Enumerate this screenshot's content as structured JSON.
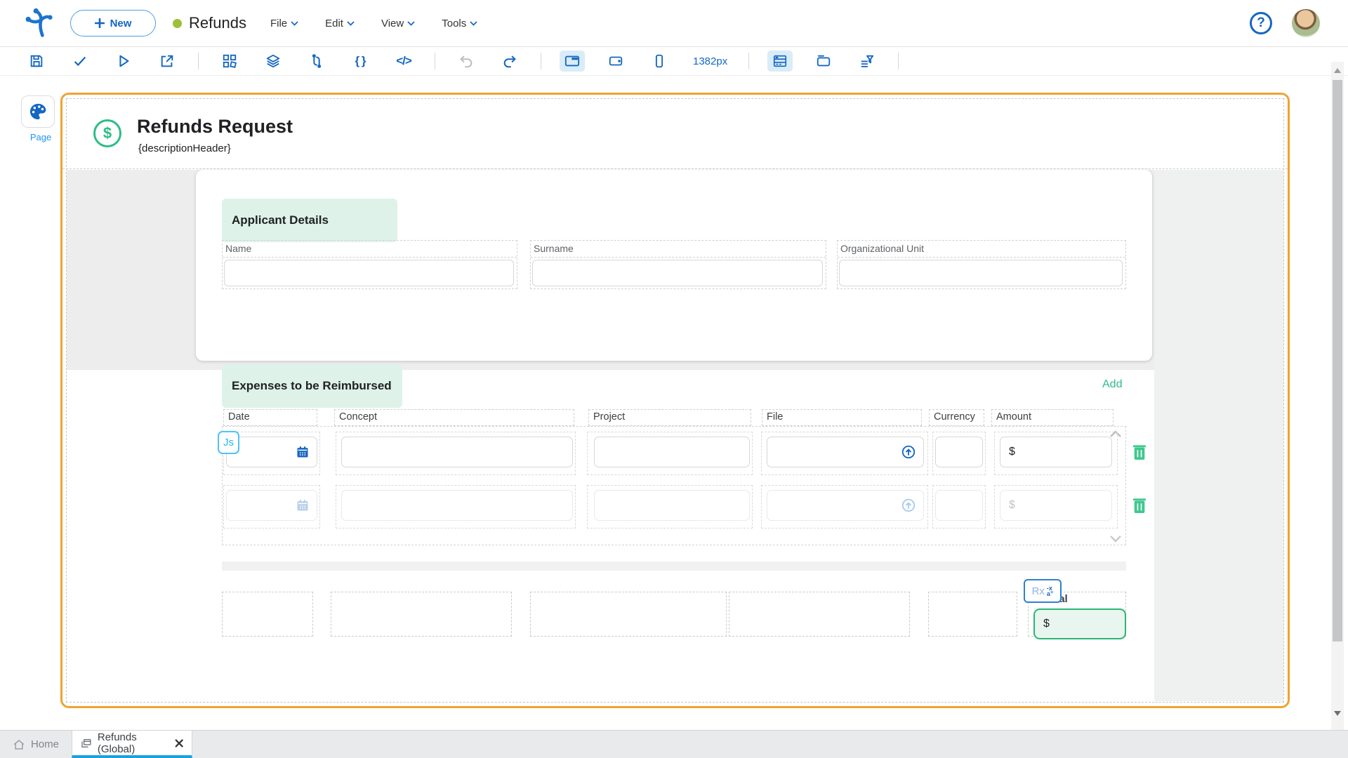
{
  "topbar": {
    "new_label": "New",
    "app_title": "Refunds",
    "menus": [
      {
        "label": "File"
      },
      {
        "label": "Edit"
      },
      {
        "label": "View"
      },
      {
        "label": "Tools"
      }
    ],
    "help_glyph": "?"
  },
  "toolbar": {
    "width_label": "1382px",
    "braces_glyph": "{ }",
    "code_glyph": "</>"
  },
  "sidebar": {
    "page_label": "Page"
  },
  "canvas": {
    "header": {
      "title": "Refunds Request",
      "subtitle": "{descriptionHeader}",
      "currency_icon": "$"
    },
    "applicant": {
      "section_title": "Applicant Details",
      "fields": [
        {
          "label": "Name"
        },
        {
          "label": "Surname"
        },
        {
          "label": "Organizational Unit"
        }
      ]
    },
    "expenses": {
      "section_title": "Expenses to be Reimbursed",
      "add_label": "Add",
      "columns": [
        "Date",
        "Concept",
        "Project",
        "File",
        "Currency",
        "Amount"
      ],
      "js_badge": "Js",
      "rx_badge": "Rx",
      "rx_glyph_top": "-x",
      "rx_glyph_bottom": "a”",
      "total_label": "Total",
      "currency_symbol": "$"
    }
  },
  "tabbar": {
    "home_label": "Home",
    "active_tab_label": "Refunds (Global)"
  },
  "colors": {
    "selection_orange": "#f0a330",
    "accent_blue": "#1467c2",
    "mint_green_bg": "#def2e9",
    "green": "#2dbd87",
    "active_tab_underline": "#19a2e0",
    "status_dot_green": "#9ebf3b"
  }
}
